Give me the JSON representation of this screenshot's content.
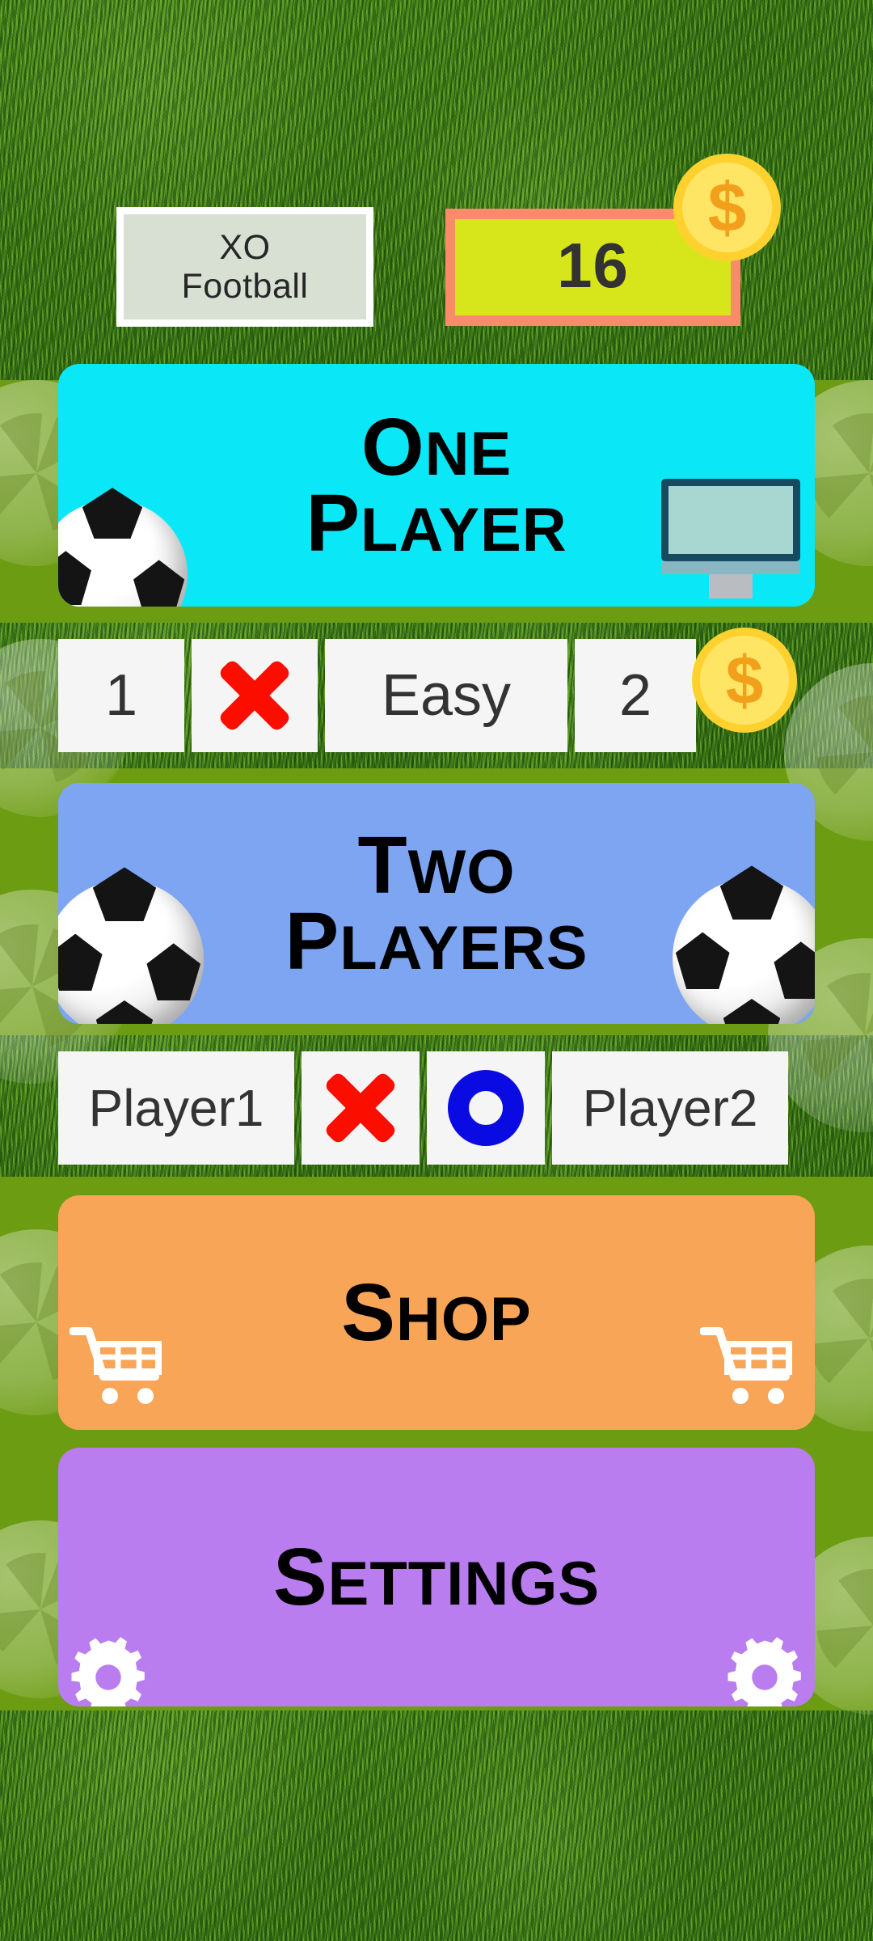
{
  "app": {
    "title_line1": "XO",
    "title_line2": "Football"
  },
  "header": {
    "coin_count": "16",
    "coin_symbol": "$"
  },
  "menu": {
    "one_player": {
      "line1": "One",
      "line2": "Player",
      "ball_icon": "soccer-ball-icon",
      "device_icon": "monitor-icon"
    },
    "two_players": {
      "line1": "Two",
      "line2": "Players",
      "ball_icon": "soccer-ball-icon"
    },
    "shop": {
      "label": "Shop",
      "cart_icon": "shopping-cart-icon"
    },
    "settings": {
      "label": "Settings",
      "gear_icon": "gear-icon"
    }
  },
  "difficulty_row": {
    "player_count": "1",
    "mark": "x-mark-icon",
    "difficulty": "Easy",
    "opponent_count": "2",
    "coin_symbol": "$"
  },
  "players_row": {
    "player1": "Player1",
    "player1_mark": "x-mark-icon",
    "player2_mark": "o-mark-icon",
    "player2": "Player2"
  },
  "colors": {
    "grass": "#3f7a18",
    "field": "#6c9c12",
    "one_player": "#0ae8f8",
    "two_players": "#7da5f2",
    "shop": "#f8a557",
    "settings": "#b97df0",
    "coin_box_bg": "#d7e61b",
    "coin_box_border": "#f98b6a",
    "coin_gold": "#ffd12e",
    "x_red": "#fb0d00",
    "o_blue": "#0a0ae3"
  }
}
